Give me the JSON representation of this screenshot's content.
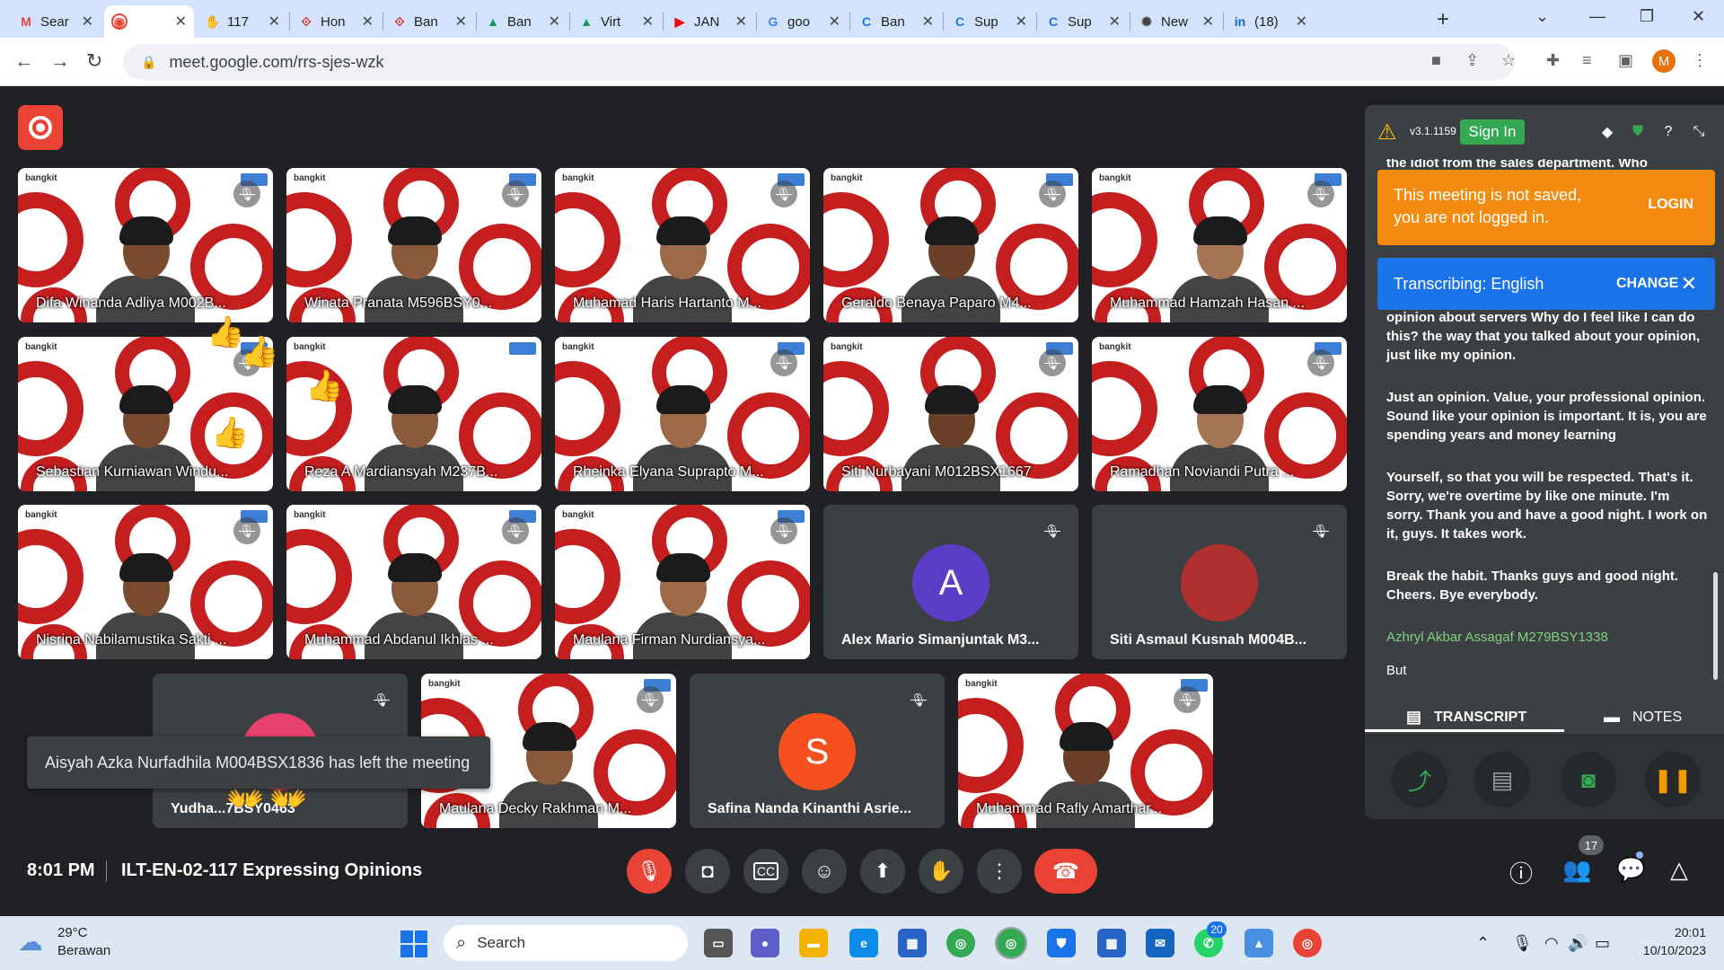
{
  "browser": {
    "tabs": [
      {
        "title": "Sear",
        "icon": "gmail-icon",
        "color": "#ea4335",
        "glyph": "M"
      },
      {
        "title": "",
        "icon": "meet-icon",
        "color": "#ffffff",
        "glyph": "◉"
      },
      {
        "title": "117",
        "icon": "emoji-icon",
        "color": "#f4b400",
        "glyph": "✋"
      },
      {
        "title": "Hon",
        "icon": "bangkit-icon",
        "color": "#d93025",
        "glyph": "⟐"
      },
      {
        "title": "Ban",
        "icon": "bangkit-icon",
        "color": "#d93025",
        "glyph": "⟐"
      },
      {
        "title": "Ban",
        "icon": "drive-icon",
        "color": "#0f9d58",
        "glyph": "▲"
      },
      {
        "title": "Virt",
        "icon": "drive-icon",
        "color": "#0f9d58",
        "glyph": "▲"
      },
      {
        "title": "JAN",
        "icon": "youtube-icon",
        "color": "#ff0000",
        "glyph": "▶"
      },
      {
        "title": "goo",
        "icon": "google-icon",
        "color": "#4285f4",
        "glyph": "G"
      },
      {
        "title": "Ban",
        "icon": "c-icon",
        "color": "#1a73e8",
        "glyph": "C"
      },
      {
        "title": "Sup",
        "icon": "c-icon",
        "color": "#1a73e8",
        "glyph": "C"
      },
      {
        "title": "Sup",
        "icon": "c-icon",
        "color": "#1a73e8",
        "glyph": "C"
      },
      {
        "title": "New",
        "icon": "chatgpt-icon",
        "color": "#444444",
        "glyph": "✺"
      },
      {
        "title": "(18)",
        "icon": "linkedin-icon",
        "color": "#0a66c2",
        "glyph": "in"
      }
    ],
    "url": "meet.google.com/rrs-sjes-wzk",
    "profile_initial": "M"
  },
  "meet": {
    "participants": [
      {
        "name": "Difa Winanda Adliya M002B...",
        "muted": true,
        "type": "video"
      },
      {
        "name": "Winata Pranata M596BSY0...",
        "muted": true,
        "type": "video"
      },
      {
        "name": "Muhamad Haris Hartanto M...",
        "muted": true,
        "type": "video"
      },
      {
        "name": "Geraldo Benaya Paparo M4...",
        "muted": true,
        "type": "video"
      },
      {
        "name": "Muhammad Hamzah Hasan ...",
        "muted": true,
        "type": "video"
      },
      {
        "name": "Sebastian Kurniawan Windu...",
        "muted": true,
        "type": "video"
      },
      {
        "name": "Reza A Mardiansyah M237B...",
        "muted": false,
        "type": "video"
      },
      {
        "name": "Rheinka Elyana Suprapto M...",
        "muted": true,
        "type": "video"
      },
      {
        "name": "Siti Nurbayani M012BSX1667",
        "muted": true,
        "type": "video"
      },
      {
        "name": "Ramadhan Noviandi Putra ...",
        "muted": true,
        "type": "video"
      },
      {
        "name": "Nisrina Nabilamustika Sakti ...",
        "muted": true,
        "type": "video"
      },
      {
        "name": "Muhammad Abdanul Ikhlas ...",
        "muted": true,
        "type": "video"
      },
      {
        "name": "Maulana Firman Nurdiansya...",
        "muted": true,
        "type": "video"
      },
      {
        "name": "Alex Mario Simanjuntak M3...",
        "muted": true,
        "type": "avatar",
        "initial": "A",
        "color": "#5b3ec8"
      },
      {
        "name": "Siti Asmaul Kusnah M004B...",
        "muted": true,
        "type": "avatar",
        "initial": "",
        "color": "#b03030"
      },
      {
        "name": "Yudha...7BSY0463",
        "muted": true,
        "type": "avatar",
        "initial": "",
        "color": "#e8416e"
      },
      {
        "name": "Maulana Decky Rakhman M...",
        "muted": true,
        "type": "video"
      },
      {
        "name": "Safina Nanda Kinanthi Asrie...",
        "muted": true,
        "type": "avatar",
        "initial": "S",
        "color": "#f4511e"
      },
      {
        "name": "Muhammad Rafly Amarthar...",
        "muted": true,
        "type": "video"
      }
    ],
    "toast": "Aisyah Azka Nurfadhila M004BSX1836 has left the meeting",
    "time": "8:01 PM",
    "title": "ILT-EN-02-117 Expressing Opinions",
    "people_count": "17",
    "logo_left": "bangkit"
  },
  "extension": {
    "version": "v3.1.1159",
    "signin_label": "Sign In",
    "transcript_top": "the idiot from the sales department. Who",
    "login_banner": {
      "message": "This meeting is not saved, you are not logged in.",
      "action": "LOGIN"
    },
    "transcribe_banner": {
      "message": "Transcribing: English",
      "action": "CHANGE"
    },
    "paragraphs": [
      "opinion about servers Why do I feel like I can do this? the way that you talked about your opinion, just like my opinion.",
      "Just an opinion. Value, your professional opinion. Sound like your opinion is important. It is, you are spending years and money learning",
      "Yourself, so that you will be respected. That's it. Sorry, we're overtime by like one minute. I'm sorry. Thank you and have a good night. I work on it, guys. It takes work.",
      "Break the habit. Thanks guys and good night. Cheers. Bye everybody."
    ],
    "speaker": "Azhryl Akbar Assagaf M279BSY1338",
    "last_line": "But",
    "tabs": {
      "transcript": "TRANSCRIPT",
      "notes": "NOTES"
    },
    "action_colors": {
      "share": "#34a853",
      "doc": "#9aa0a6",
      "camera": "#34a853",
      "pause": "#f29900"
    }
  },
  "taskbar": {
    "weather_temp": "29°C",
    "weather_desc": "Berawan",
    "search_placeholder": "Search",
    "whatsapp_badge": "20",
    "clock_time": "20:01",
    "clock_date": "10/10/2023"
  }
}
